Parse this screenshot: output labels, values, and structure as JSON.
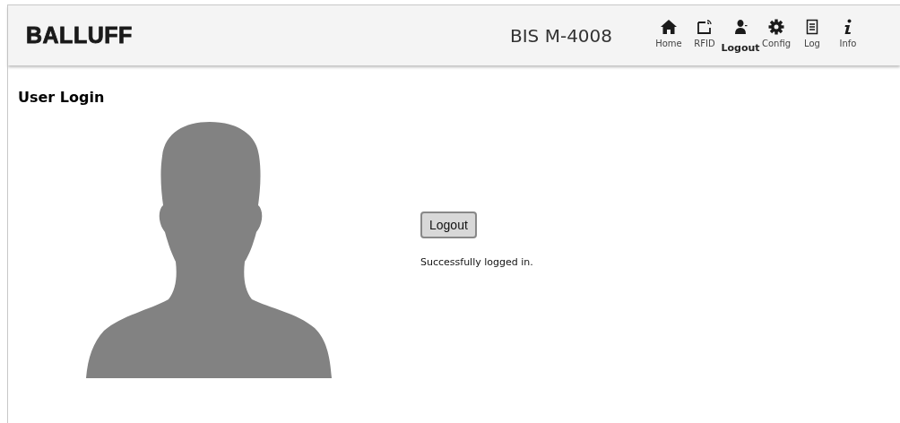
{
  "header": {
    "logo": "BALLUFF",
    "device_name": "BIS M-4008",
    "nav": [
      {
        "kind": "home",
        "label": "Home",
        "selected": false
      },
      {
        "kind": "rfid",
        "label": "RFID",
        "selected": false
      },
      {
        "kind": "user",
        "label": "Logout",
        "selected": true
      },
      {
        "kind": "config",
        "label": "Config",
        "selected": false
      },
      {
        "kind": "log",
        "label": "Log",
        "selected": false
      },
      {
        "kind": "info",
        "label": "Info",
        "selected": false
      }
    ]
  },
  "page": {
    "title": "User Login",
    "button": "Logout",
    "message": "Successfully logged in."
  }
}
